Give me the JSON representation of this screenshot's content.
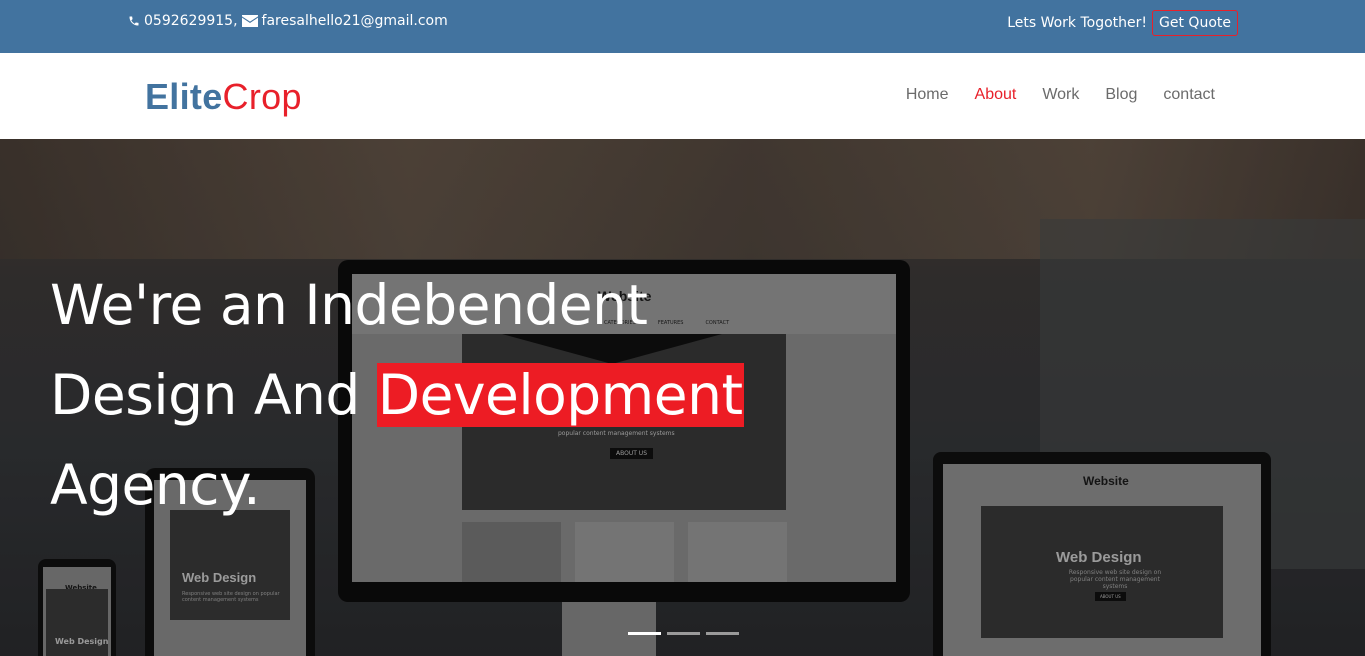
{
  "topbar": {
    "phone": "0592629915,",
    "email": "faresalhello21@gmail.com",
    "tagline": "Lets Work Togother!",
    "quote_label": "Get Quote",
    "icons": {
      "phone": "phone-icon",
      "email": "envelope-icon"
    }
  },
  "brand": {
    "part1": "Elite",
    "part2": "Crop"
  },
  "nav": {
    "items": [
      "Home",
      "About",
      "Work",
      "Blog",
      "contact"
    ],
    "active": "About"
  },
  "hero": {
    "line1": "We're an Indebendent",
    "line2_plain": "Design And ",
    "line2_highlight": "Development",
    "line3": "Agency.",
    "monitor_site": "Website",
    "monitor_nav": [
      "CATEGORIES",
      "FEATURES",
      "CONTACT"
    ],
    "monitor_sub": "popular content management systems",
    "monitor_btn": "ABOUT US",
    "device_title": "Web Design",
    "device_sub": "Responsive web site design on popular content management systems",
    "device_btn": "ABOUT US",
    "slides": 3,
    "active_slide": 0
  },
  "colors": {
    "primary": "#42739f",
    "accent": "#ed1c24"
  }
}
